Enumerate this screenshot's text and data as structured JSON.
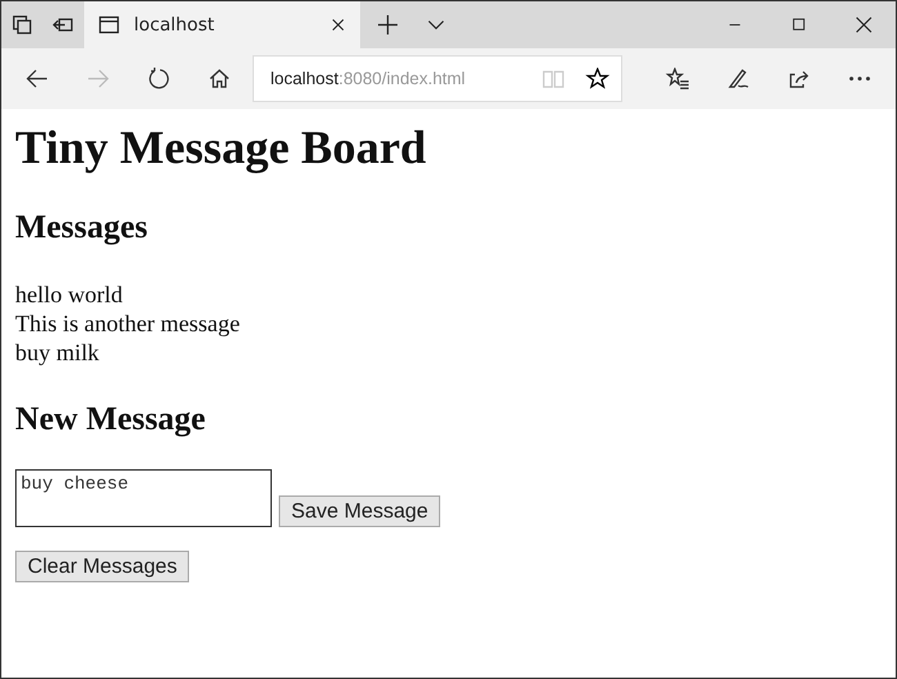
{
  "browser": {
    "tab": {
      "title": "localhost",
      "selected": true
    },
    "url_host": "localhost",
    "url_path": ":8080/index.html"
  },
  "page": {
    "title": "Tiny Message Board",
    "messages_heading": "Messages",
    "messages": [
      "hello world",
      "This is another message",
      "buy milk"
    ],
    "new_heading": "New Message",
    "message_input": "buy cheese",
    "save_button": "Save Message",
    "clear_button": "Clear Messages"
  }
}
